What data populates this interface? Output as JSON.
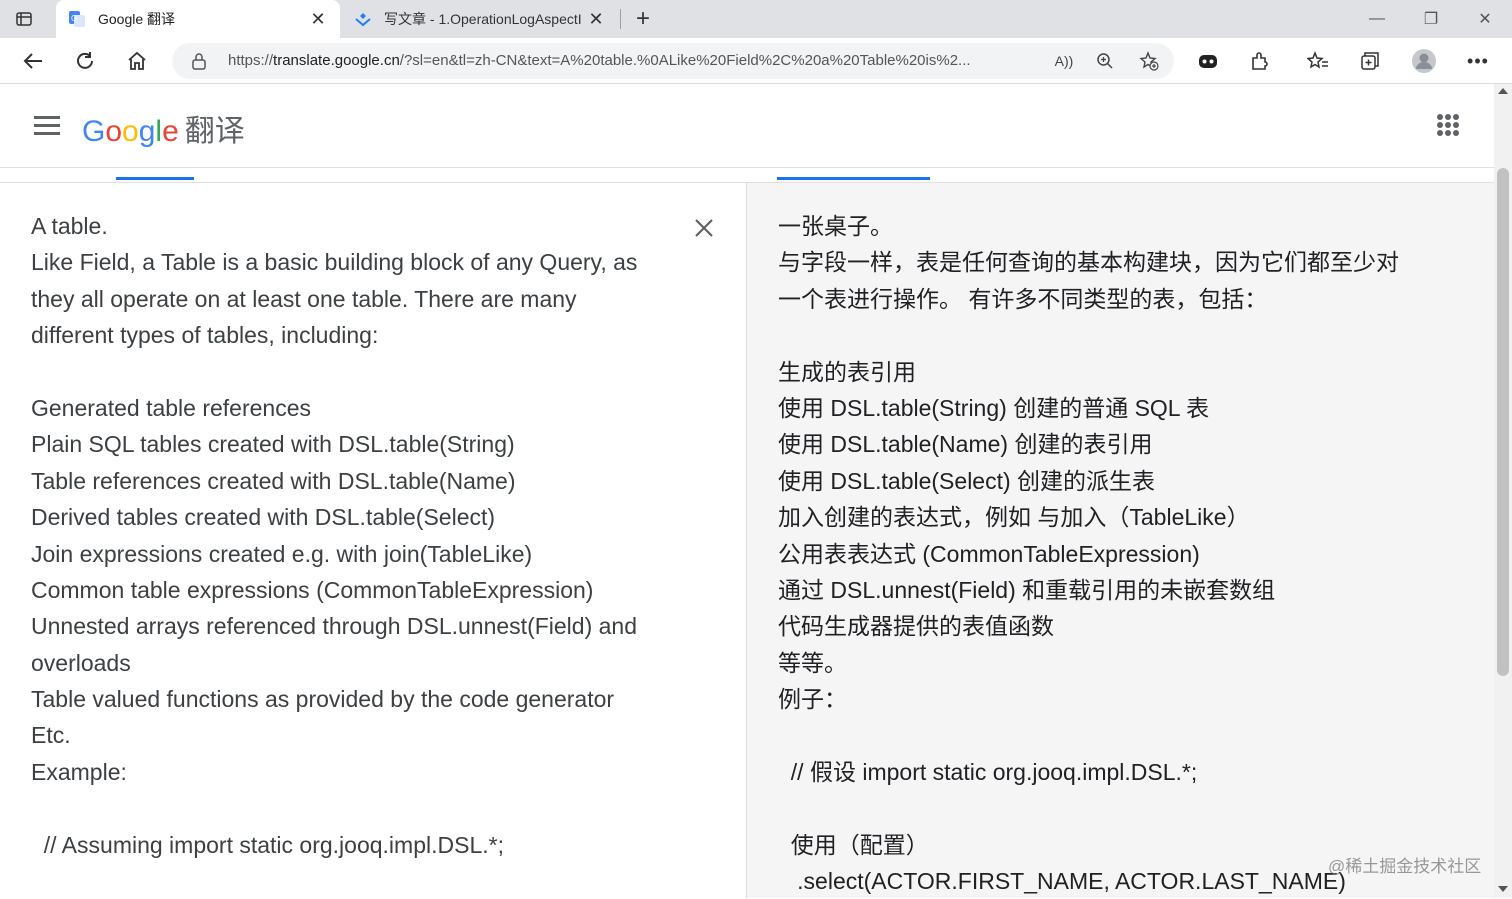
{
  "browser": {
    "tabs": [
      {
        "title": "Google 翻译",
        "active": true
      },
      {
        "title": "写文章 - 1.OperationLogAspectI",
        "active": false
      }
    ],
    "url_prefix": "https://",
    "url_host": "translate.google.cn",
    "url_rest": "/?sl=en&tl=zh-CN&text=A%20table.%0ALike%20Field%2C%20a%20Table%20is%2...",
    "read_aloud_label": "A"
  },
  "header": {
    "logo_letters": [
      "G",
      "o",
      "o",
      "g",
      "l",
      "e"
    ],
    "product_name": "翻译"
  },
  "source": {
    "lines": [
      "A table.",
      "Like Field, a Table is a basic building block of any Query, as",
      "they all operate on at least one table. There are many",
      "different types of tables, including:",
      "",
      "Generated table references",
      "Plain SQL tables created with DSL.table(String)",
      "Table references created with DSL.table(Name)",
      "Derived tables created with DSL.table(Select)",
      "Join expressions created e.g. with join(TableLike)",
      "Common table expressions (CommonTableExpression)",
      "Unnested arrays referenced through DSL.unnest(Field) and",
      "overloads",
      "Table valued functions as provided by the code generator",
      "Etc.",
      "Example:",
      "",
      "  // Assuming import static org.jooq.impl.DSL.*;"
    ]
  },
  "translation": {
    "lines": [
      "一张桌子。",
      "与字段一样，表是任何查询的基本构建块，因为它们都至少对",
      "一个表进行操作。 有许多不同类型的表，包括：",
      "",
      "生成的表引用",
      "使用 DSL.table(String) 创建的普通 SQL 表",
      "使用 DSL.table(Name) 创建的表引用",
      "使用 DSL.table(Select) 创建的派生表",
      "加入创建的表达式，例如 与加入（TableLike）",
      "公用表表达式 (CommonTableExpression)",
      "通过 DSL.unnest(Field) 和重载引用的未嵌套数组",
      "代码生成器提供的表值函数",
      "等等。",
      "例子：",
      "",
      "  // 假设 import static org.jooq.impl.DSL.*;",
      "",
      "  使用（配置）",
      "   .select(ACTOR.FIRST_NAME, ACTOR.LAST_NAME)"
    ]
  },
  "watermark": "@稀土掘金技术社区",
  "colors": {
    "accent": "#1a73e8",
    "right_pane_bg": "#f5f5f5"
  }
}
